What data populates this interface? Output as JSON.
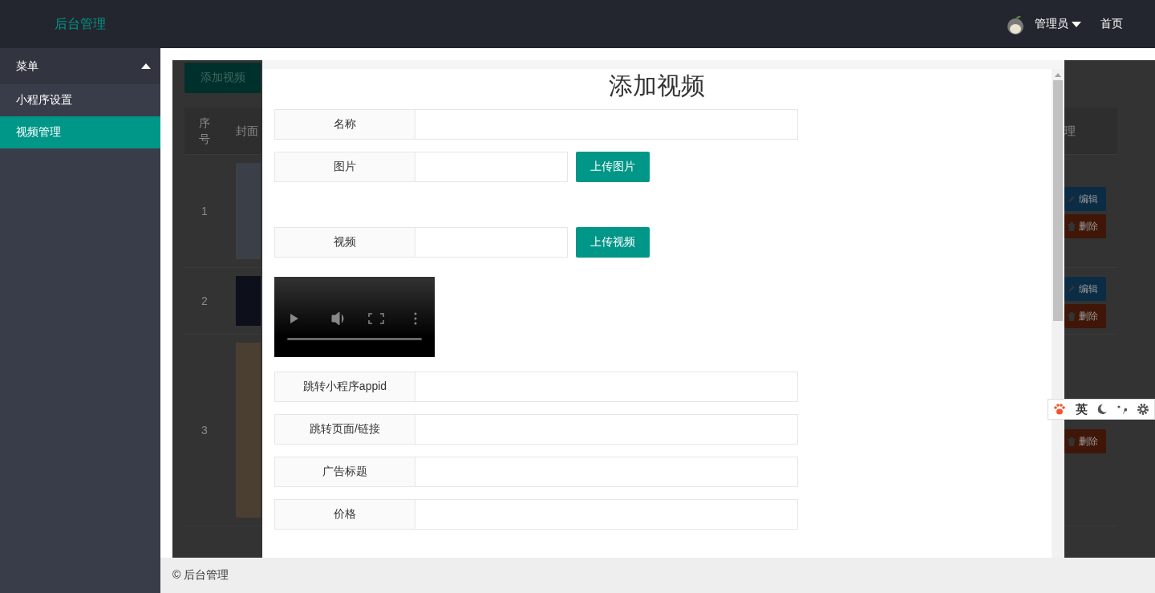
{
  "header": {
    "title": "后台管理",
    "user": "管理员",
    "home": "首页"
  },
  "sidebar": {
    "menu_title": "菜单",
    "expanded": true,
    "items": [
      {
        "label": "小程序设置",
        "selected": false
      },
      {
        "label": "视频管理",
        "selected": true
      }
    ]
  },
  "background": {
    "add_button": "添加视频",
    "columns": [
      "序号",
      "封面",
      "理"
    ],
    "rows": [
      {
        "index": "1",
        "actions": [
          {
            "label": "编辑",
            "kind": "edit"
          },
          {
            "label": "删除",
            "kind": "delete"
          }
        ]
      },
      {
        "index": "2",
        "actions": [
          {
            "label": "编辑",
            "kind": "edit"
          },
          {
            "label": "删除",
            "kind": "delete"
          }
        ]
      },
      {
        "index": "3",
        "actions": [
          {
            "label": "删除",
            "kind": "delete"
          }
        ]
      }
    ]
  },
  "modal": {
    "title": "添加视频",
    "fields": [
      {
        "kind": "text",
        "label": "名称"
      },
      {
        "kind": "upload",
        "label": "图片",
        "button": "上传图片"
      },
      {
        "kind": "upload",
        "label": "视频",
        "button": "上传视频"
      },
      {
        "kind": "video"
      },
      {
        "kind": "text",
        "label": "跳转小程序appid"
      },
      {
        "kind": "text",
        "label": "跳转页面/链接"
      },
      {
        "kind": "text",
        "label": "广告标题"
      },
      {
        "kind": "text",
        "label": "价格"
      }
    ]
  },
  "ime": {
    "mode": "英"
  },
  "footer": "© 后台管理"
}
